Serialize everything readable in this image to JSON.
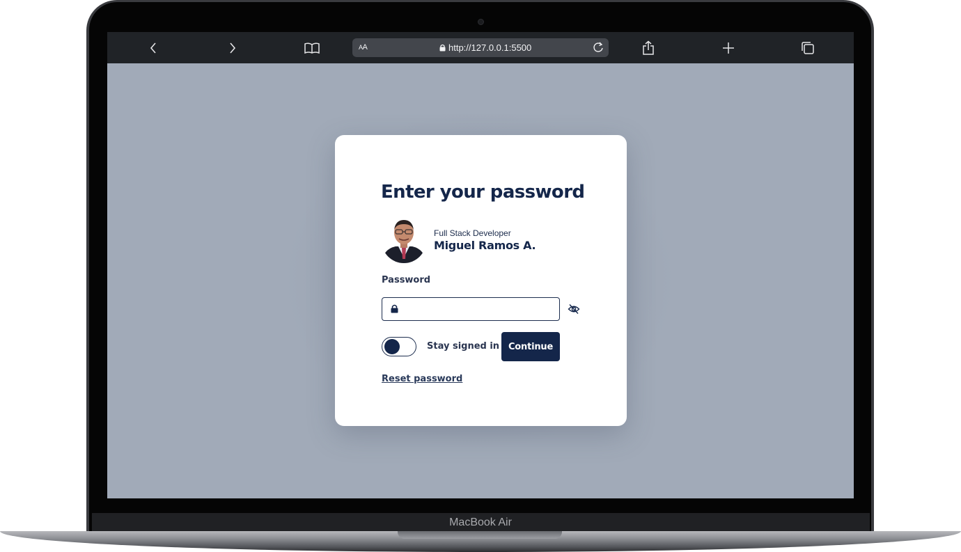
{
  "browser": {
    "back_icon": "chevron-left-icon",
    "forward_icon": "chevron-right-icon",
    "bookmarks_icon": "book-icon",
    "text_size_label_small": "A",
    "text_size_label_large": "A",
    "url": "http://127.0.0.1:5500",
    "share_icon": "share-icon",
    "new_tab_icon": "plus-icon",
    "tabs_icon": "tabs-icon"
  },
  "login": {
    "title": "Enter your password",
    "user_role": "Full Stack Developer",
    "user_name": "Miguel Ramos A.",
    "password_label": "Password",
    "password_value": "",
    "stay_signed_in_label": "Stay signed in",
    "stay_signed_in_on": false,
    "continue_label": "Continue",
    "reset_label": "Reset password"
  },
  "device": {
    "model": "MacBook Air"
  },
  "colors": {
    "primary": "#14264a",
    "page_background": "#a1aab8",
    "card_background": "#ffffff",
    "toolbar": "#202327"
  }
}
